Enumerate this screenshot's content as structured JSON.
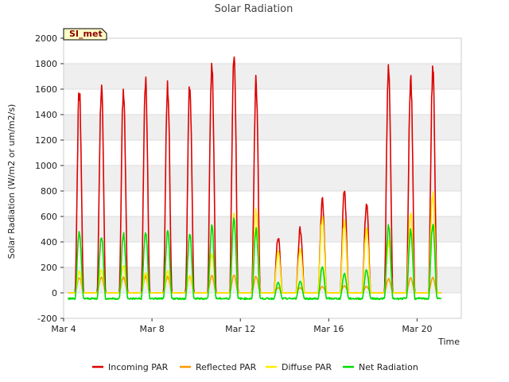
{
  "chart_data": {
    "type": "line",
    "title": "Solar Radiation",
    "xlabel": "Time",
    "ylabel": "Solar Radiation (W/m2 or um/m2/s)",
    "ylim": [
      -200,
      2000
    ],
    "xlim_days": [
      4,
      22
    ],
    "yticks": [
      -200,
      0,
      200,
      400,
      600,
      800,
      1000,
      1200,
      1400,
      1600,
      1800,
      2000
    ],
    "xticks": [
      {
        "label": "Mar 4",
        "day": 4
      },
      {
        "label": "Mar 8",
        "day": 8
      },
      {
        "label": "Mar 12",
        "day": 12
      },
      {
        "label": "Mar 16",
        "day": 16
      },
      {
        "label": "Mar 20",
        "day": 20
      }
    ],
    "grid": true,
    "legend": "bottom",
    "site_badge": "SI_met",
    "x_unit_note": "x values are day of March; each series is a daily diurnal cycle",
    "series": [
      {
        "name": "Incoming PAR",
        "color": "#dd0000",
        "daily_peaks": [
          {
            "day": 4.7,
            "peak": 1580
          },
          {
            "day": 5.7,
            "peak": 1600
          },
          {
            "day": 6.7,
            "peak": 1610
          },
          {
            "day": 7.7,
            "peak": 1630
          },
          {
            "day": 8.7,
            "peak": 1620
          },
          {
            "day": 9.7,
            "peak": 1630
          },
          {
            "day": 10.7,
            "peak": 1820
          },
          {
            "day": 11.7,
            "peak": 1910
          },
          {
            "day": 12.7,
            "peak": 1680
          },
          {
            "day": 13.7,
            "peak": 440
          },
          {
            "day": 14.7,
            "peak": 500
          },
          {
            "day": 15.7,
            "peak": 720
          },
          {
            "day": 16.7,
            "peak": 800
          },
          {
            "day": 17.7,
            "peak": 700
          },
          {
            "day": 18.7,
            "peak": 1780
          },
          {
            "day": 19.7,
            "peak": 1680
          },
          {
            "day": 20.7,
            "peak": 1750
          }
        ],
        "night_value": 0
      },
      {
        "name": "Reflected PAR",
        "color": "#ff9900",
        "daily_peaks": [
          {
            "day": 4.7,
            "peak": 120
          },
          {
            "day": 5.7,
            "peak": 120
          },
          {
            "day": 6.7,
            "peak": 120
          },
          {
            "day": 7.7,
            "peak": 130
          },
          {
            "day": 8.7,
            "peak": 125
          },
          {
            "day": 9.7,
            "peak": 125
          },
          {
            "day": 10.7,
            "peak": 135
          },
          {
            "day": 11.7,
            "peak": 140
          },
          {
            "day": 12.7,
            "peak": 130
          },
          {
            "day": 13.7,
            "peak": 40
          },
          {
            "day": 14.7,
            "peak": 40
          },
          {
            "day": 15.7,
            "peak": 50
          },
          {
            "day": 16.7,
            "peak": 55
          },
          {
            "day": 17.7,
            "peak": 50
          },
          {
            "day": 18.7,
            "peak": 110
          },
          {
            "day": 19.7,
            "peak": 115
          },
          {
            "day": 20.7,
            "peak": 120
          }
        ],
        "night_value": 0
      },
      {
        "name": "Diffuse PAR",
        "color": "#ffee00",
        "daily_peaks": [
          {
            "day": 4.7,
            "peak": 170
          },
          {
            "day": 5.7,
            "peak": 180
          },
          {
            "day": 6.7,
            "peak": 220
          },
          {
            "day": 7.7,
            "peak": 160
          },
          {
            "day": 8.7,
            "peak": 170
          },
          {
            "day": 9.7,
            "peak": 140
          },
          {
            "day": 10.7,
            "peak": 310
          },
          {
            "day": 11.7,
            "peak": 610
          },
          {
            "day": 12.7,
            "peak": 650
          },
          {
            "day": 13.7,
            "peak": 320
          },
          {
            "day": 14.7,
            "peak": 340
          },
          {
            "day": 15.7,
            "peak": 590
          },
          {
            "day": 16.7,
            "peak": 560
          },
          {
            "day": 17.7,
            "peak": 500
          },
          {
            "day": 18.7,
            "peak": 400
          },
          {
            "day": 19.7,
            "peak": 640
          },
          {
            "day": 20.7,
            "peak": 780
          }
        ],
        "night_value": 0
      },
      {
        "name": "Net Radiation",
        "color": "#00dd00",
        "daily_peaks": [
          {
            "day": 4.7,
            "peak": 470
          },
          {
            "day": 5.7,
            "peak": 450
          },
          {
            "day": 6.7,
            "peak": 460
          },
          {
            "day": 7.7,
            "peak": 475
          },
          {
            "day": 8.7,
            "peak": 470
          },
          {
            "day": 9.7,
            "peak": 460
          },
          {
            "day": 10.7,
            "peak": 520
          },
          {
            "day": 11.7,
            "peak": 590
          },
          {
            "day": 12.7,
            "peak": 500
          },
          {
            "day": 13.7,
            "peak": 80
          },
          {
            "day": 14.7,
            "peak": 90
          },
          {
            "day": 15.7,
            "peak": 200
          },
          {
            "day": 16.7,
            "peak": 150
          },
          {
            "day": 17.7,
            "peak": 180
          },
          {
            "day": 18.7,
            "peak": 520
          },
          {
            "day": 19.7,
            "peak": 490
          },
          {
            "day": 20.7,
            "peak": 540
          }
        ],
        "night_value": -45
      }
    ]
  }
}
